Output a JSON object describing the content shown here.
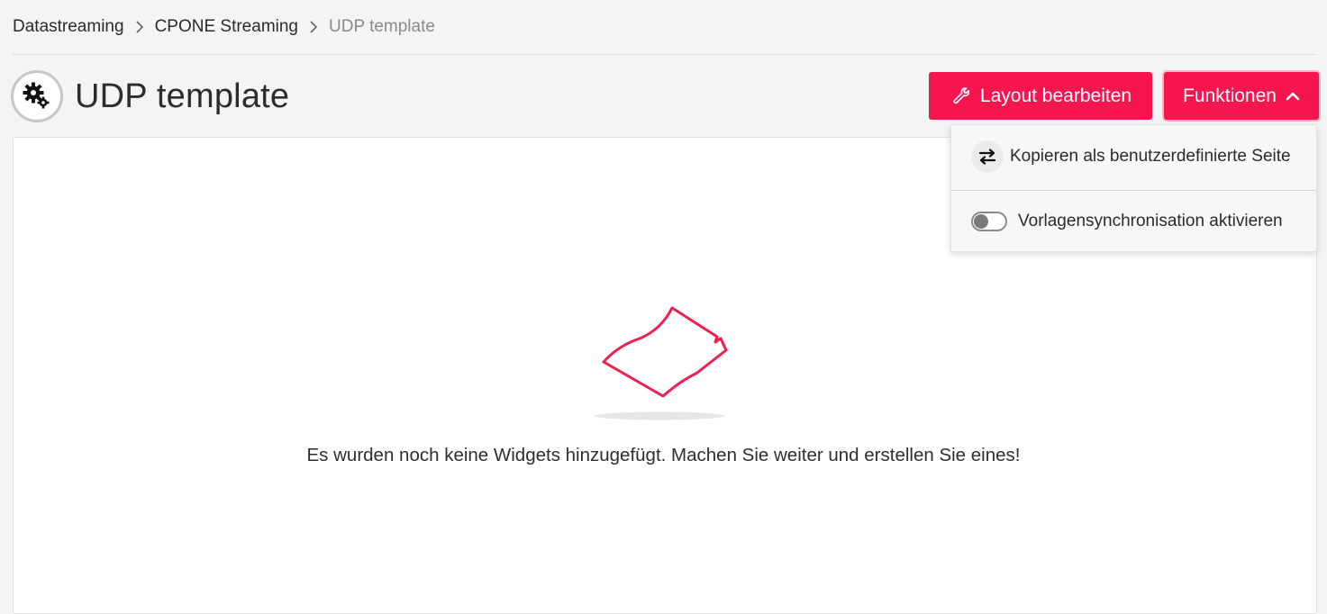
{
  "breadcrumb": {
    "items": [
      "Datastreaming",
      "CPONE Streaming",
      "UDP template"
    ]
  },
  "page": {
    "title": "UDP template",
    "icon": "gears-icon"
  },
  "toolbar": {
    "layout_label": "Layout bearbeiten",
    "functions_label": "Funktionen",
    "accent_color": "#f5154f"
  },
  "functions_menu": {
    "expanded": true,
    "items": [
      {
        "label": "Kopieren als benutzerdefinierte Seite",
        "icon": "swap-arrows-icon"
      },
      {
        "label": "Vorlagensynchronisation aktivieren",
        "icon": "toggle-switch",
        "toggle_on": false
      }
    ]
  },
  "empty_state": {
    "message": "Es wurden noch keine Widgets hinzugefügt. Machen Sie weiter und erstellen Sie eines!",
    "icon": "empty-page-icon"
  }
}
